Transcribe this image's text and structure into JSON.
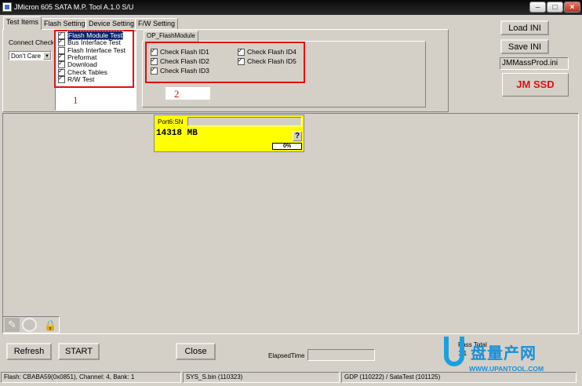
{
  "window": {
    "title": "JMicron 605 SATA M.P. Tool A.1.0 S/U"
  },
  "tabs": [
    "Test Items",
    "Flash Setting",
    "Device Setting",
    "F/W Setting"
  ],
  "connect_check": {
    "label": "Connect Check",
    "value": "Don't Care"
  },
  "test_items": [
    {
      "label": "Flash Module Test",
      "checked": true
    },
    {
      "label": "Bus Interface Test",
      "checked": true
    },
    {
      "label": "Flash Interface Test",
      "checked": false
    },
    {
      "label": "Preformat",
      "checked": true
    },
    {
      "label": "Download",
      "checked": true
    },
    {
      "label": "Check Tables",
      "checked": true
    },
    {
      "label": "R/W Test",
      "checked": true
    }
  ],
  "annot1": "1",
  "annot2": "2",
  "op_tab": "OP_FlashModule",
  "flash_checks_left": [
    "Check Flash ID1",
    "Check Flash ID2",
    "Check Flash ID3"
  ],
  "flash_checks_right": [
    "Check Flash ID4",
    "Check Flash ID5"
  ],
  "buttons": {
    "load_ini": "Load INI",
    "save_ini": "Save INI",
    "refresh": "Refresh",
    "start": "START",
    "close": "Close"
  },
  "ini_file": "JMMassProd.ini",
  "brand": "JM SSD",
  "port": {
    "label": "Port6:SN",
    "capacity": "14318 MB",
    "percent": "0%",
    "help": "?"
  },
  "elapsed_label": "ElapsedTime",
  "pass_total": {
    "label": "Pass Total",
    "value": "1/1"
  },
  "watermark": {
    "logo": "盘量产网",
    "url": "WWW.UPANTOOL.COM"
  },
  "status": {
    "flash": "Flash: CBABA59(0x0851), Channel: 4, Bank: 1",
    "sys": "SYS_S.bin (110323)",
    "gdp": "GDP (110222) / SataTest (101125)"
  }
}
